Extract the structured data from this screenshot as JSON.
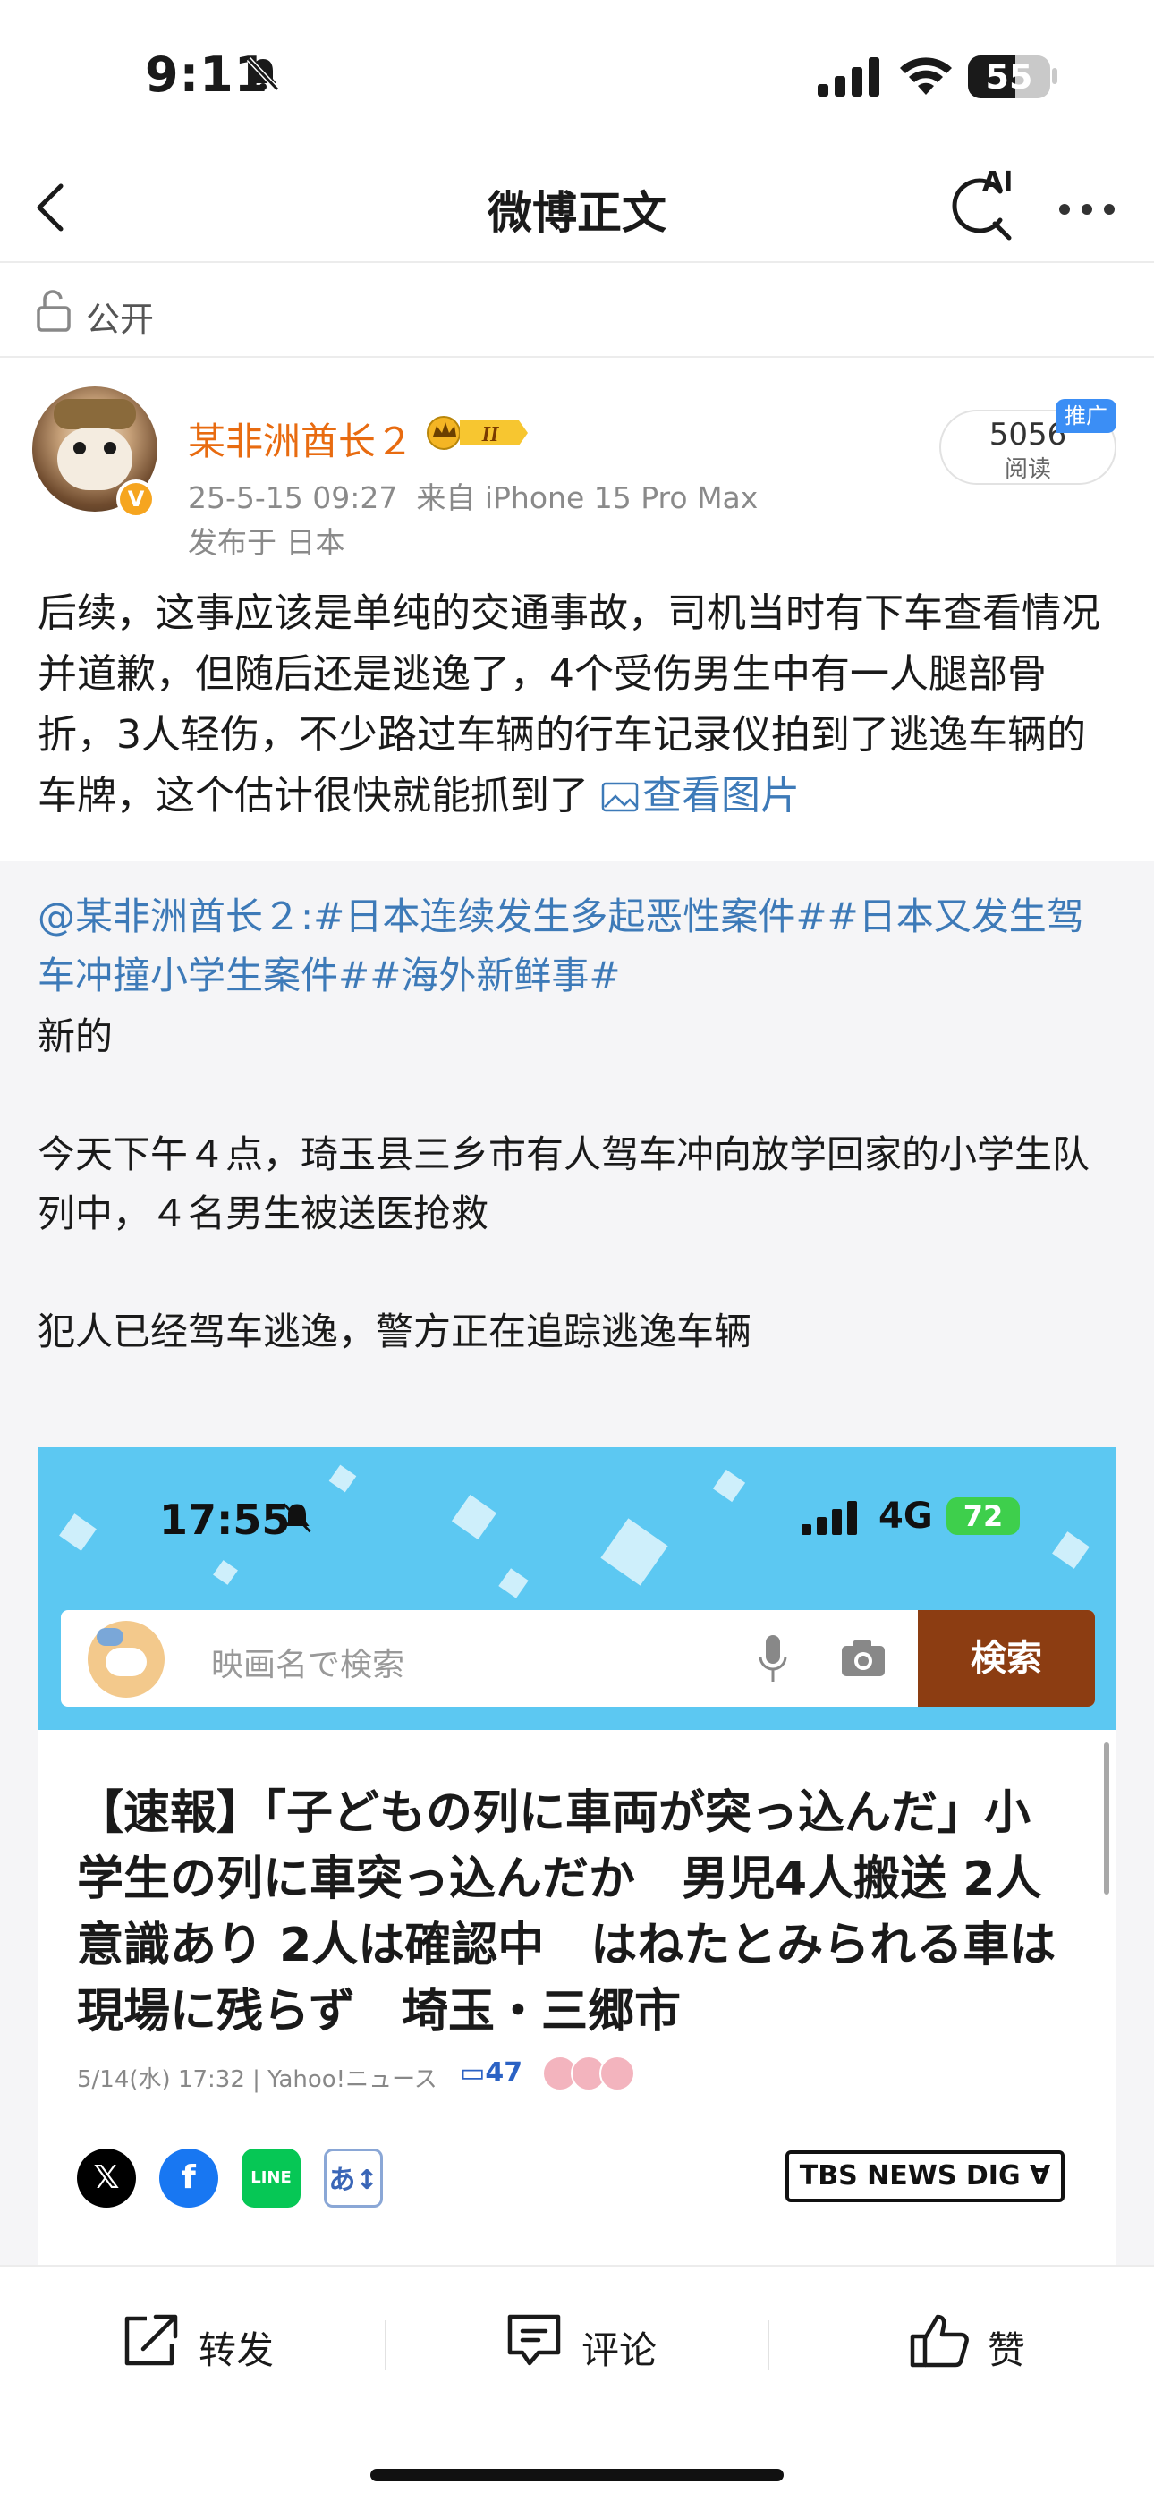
{
  "status_bar": {
    "time": "9:11",
    "battery": "55"
  },
  "nav": {
    "title": "微博正文",
    "ai_label": "AI"
  },
  "visibility": {
    "label": "公开"
  },
  "author": {
    "name": "某非洲酋长２",
    "badge": "II",
    "timestamp": "25-5-15 09:27",
    "source": "来自 iPhone 15 Pro Max",
    "location": "发布于 日本",
    "read_count": "5056",
    "read_label": "阅读",
    "promo_label": "推广"
  },
  "post": {
    "text": "后续，这事应该是单纯的交通事故，司机当时有下车查看情况并道歉，但随后还是逃逸了，4个受伤男生中有一人腿部骨折，3人轻伤，不少路过车辆的行车记录仪拍到了逃逸车辆的车牌，这个估计很快就能抓到了",
    "view_pic_label": "查看图片"
  },
  "repost": {
    "author_link": "@某非洲酋长２",
    "colon": ":",
    "hashtags": "#日本连续发生多起恶性案件##日本又发生驾车冲撞小学生案件##海外新鲜事#",
    "paragraphs": [
      "新的",
      "今天下午４点，琦玉县三乡市有人驾车冲向放学回家的小学生队列中，４名男生被送医抢救",
      "犯人已经驾车逃逸，警方正在追踪逃逸车辆"
    ]
  },
  "embedded": {
    "time": "17:55",
    "network": "4G",
    "battery": "72",
    "search_placeholder": "映画名で検索",
    "search_button": "検索",
    "headline": "【速報】「子どもの列に車両が突っ込んだ」小学生の列に車突っ込んだか　男児4人搬送 2人意識あり 2人は確認中　はねたとみられる車は現場に残らず　埼玉・三郷市",
    "meta": "5/14(水) 17:32 | Yahoo!ニュース",
    "comment_count": "47",
    "share_x": "𝕏",
    "share_fb": "f",
    "share_line": "LINE",
    "share_lang": "あ↕",
    "source_logo": "TBS NEWS DIG ∀"
  },
  "actions": {
    "repost": "转发",
    "comment": "评论",
    "like": "赞"
  }
}
